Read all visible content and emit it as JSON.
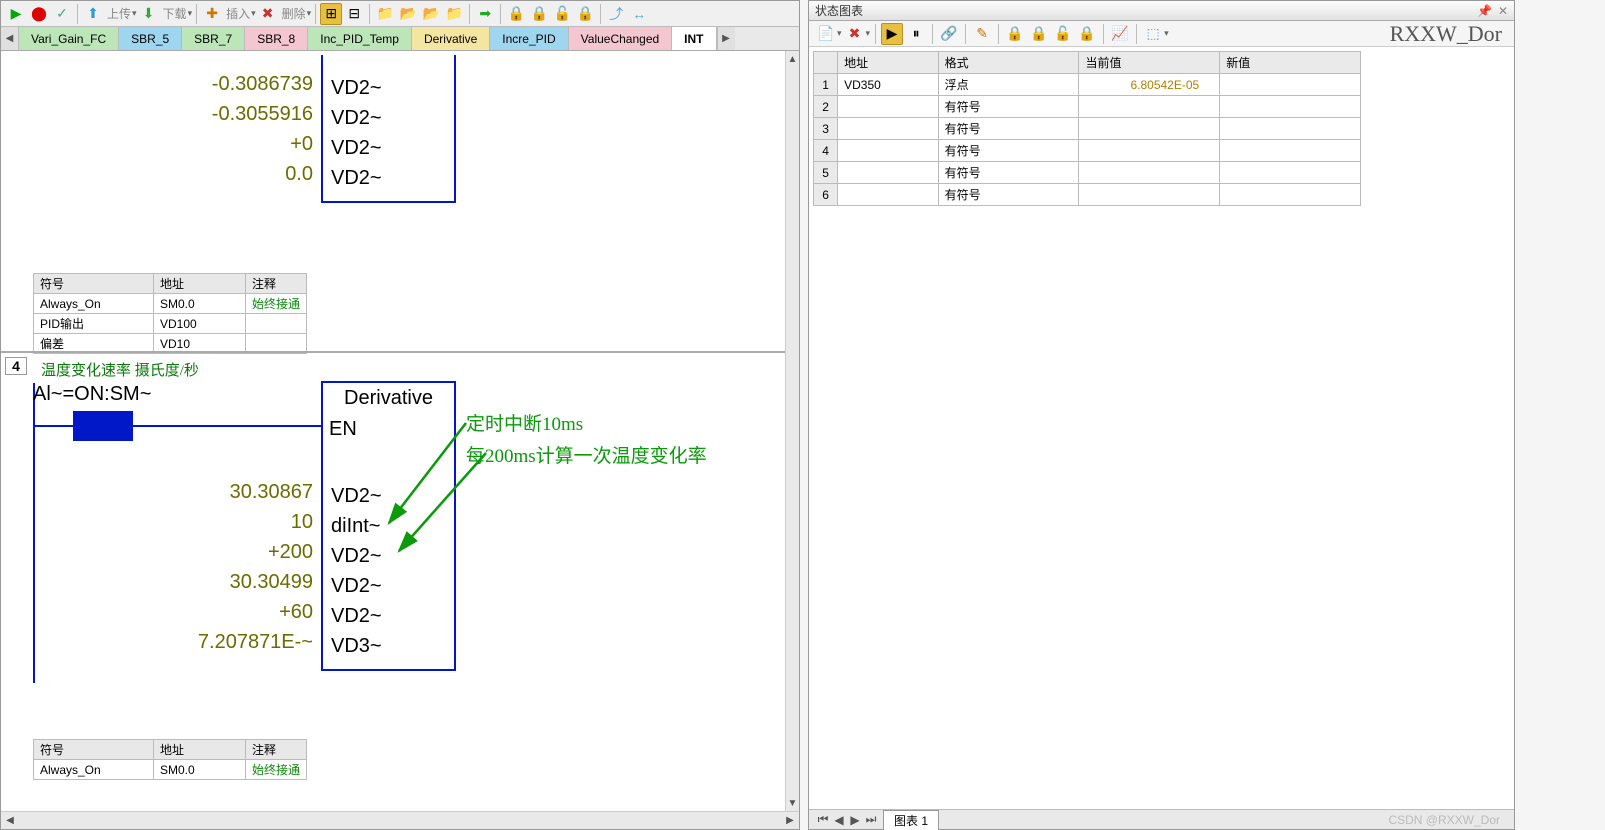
{
  "toolbar": {
    "upload": "上传",
    "download": "下载",
    "insert": "插入",
    "delete": "删除"
  },
  "tabs": [
    "Vari_Gain_FC",
    "SBR_5",
    "SBR_7",
    "SBR_8",
    "Inc_PID_Temp",
    "Derivative",
    "Incre_PID",
    "ValueChanged",
    "INT"
  ],
  "block1": {
    "rows": [
      {
        "val": "-0.3086739",
        "name": "VD2~"
      },
      {
        "val": "-0.3055916",
        "name": "VD2~"
      },
      {
        "val": "+0",
        "name": "VD2~"
      },
      {
        "val": "0.0",
        "name": "VD2~"
      }
    ]
  },
  "sym1": {
    "headers": [
      "符号",
      "地址",
      "注释"
    ],
    "rows": [
      [
        "Always_On",
        "SM0.0",
        "始终接通"
      ],
      [
        "PID输出",
        "VD100",
        ""
      ],
      [
        "偏差",
        "VD10",
        ""
      ]
    ]
  },
  "rung4": {
    "num": "4",
    "comment": "温度变化速率  摄氏度/秒",
    "contact": "Al~=ON:SM~",
    "block_title": "Derivative",
    "en": "EN",
    "annot1": "定时中断10ms",
    "annot2": "每200ms计算一次温度变化率",
    "rows": [
      {
        "val": "30.30867",
        "name": "VD2~"
      },
      {
        "val": "10",
        "name": "diInt~"
      },
      {
        "val": "+200",
        "name": "VD2~"
      },
      {
        "val": "30.30499",
        "name": "VD2~"
      },
      {
        "val": "+60",
        "name": "VD2~"
      },
      {
        "val": "7.207871E-~",
        "name": "VD3~"
      }
    ]
  },
  "sym2": {
    "headers": [
      "符号",
      "地址",
      "注释"
    ],
    "rows": [
      [
        "Always_On",
        "SM0.0",
        "始终接通"
      ]
    ]
  },
  "right": {
    "title": "状态图表",
    "brand": "RXXW_Dor",
    "headers": [
      "",
      "地址",
      "格式",
      "当前值",
      "新值"
    ],
    "rows": [
      {
        "n": "1",
        "addr": "VD350",
        "fmt": "浮点",
        "cur": "6.80542E-05",
        "new": ""
      },
      {
        "n": "2",
        "addr": "",
        "fmt": "有符号",
        "cur": "",
        "new": ""
      },
      {
        "n": "3",
        "addr": "",
        "fmt": "有符号",
        "cur": "",
        "new": ""
      },
      {
        "n": "4",
        "addr": "",
        "fmt": "有符号",
        "cur": "",
        "new": ""
      },
      {
        "n": "5",
        "addr": "",
        "fmt": "有符号",
        "cur": "",
        "new": ""
      },
      {
        "n": "6",
        "addr": "",
        "fmt": "有符号",
        "cur": "",
        "new": ""
      }
    ],
    "chart_tab": "图表 1",
    "watermark": "CSDN @RXXW_Dor"
  }
}
